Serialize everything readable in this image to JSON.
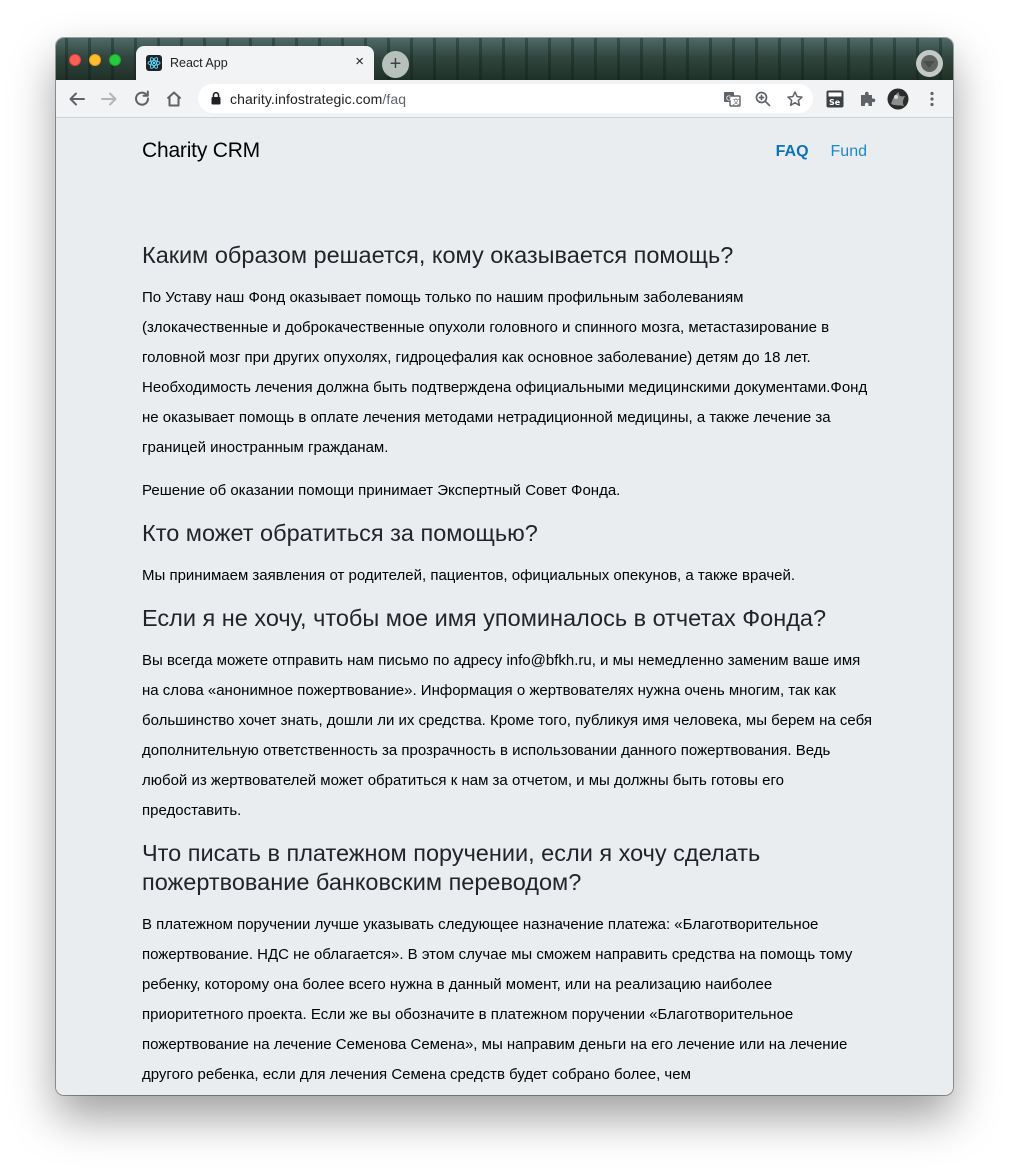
{
  "browser": {
    "tab_title": "React App",
    "tab_close": "×",
    "new_tab": "+",
    "url_host": "charity.infostrategic.com",
    "url_path": "/faq",
    "colors": {
      "traffic_red": "#fe5f57",
      "traffic_yellow": "#febc2e",
      "traffic_green": "#28c840"
    }
  },
  "header": {
    "brand": "Charity CRM",
    "nav": [
      {
        "label": "FAQ",
        "active": true
      },
      {
        "label": "Fund",
        "active": false
      }
    ],
    "link_color": "#1e87c9"
  },
  "faq": [
    {
      "question": "Каким образом решается, кому оказывается помощь?",
      "answers": [
        "По Уставу наш Фонд оказывает помощь только по нашим профильным заболеваниям (злокачественные и доброкачественные опухоли головного и спинного мозга, метастазирование в головной мозг при других опухолях, гидроцефалия как основное заболевание) детям до 18 лет. Необходимость лечения должна быть подтверждена официальными медицинскими документами.Фонд не оказывает помощь в оплате лечения методами нетрадиционной медицины, а также лечение за границей иностранным гражданам.",
        "Решение об оказании помощи принимает Экспертный Совет Фонда."
      ]
    },
    {
      "question": "Кто может обратиться за помощью?",
      "answers": [
        "Мы принимаем заявления от родителей, пациентов, официальных опекунов, а также врачей."
      ]
    },
    {
      "question": "Если я не хочу, чтобы мое имя упоминалось в отчетах Фонда?",
      "answers": [
        "Вы всегда можете отправить нам письмо по адресу info@bfkh.ru, и мы немедленно заменим ваше имя на слова «анонимное пожертвование». Информация о жертвователях нужна очень многим, так как большинство хочет знать, дошли ли их средства. Кроме того, публикуя имя человека, мы берем на себя дополнительную ответственность за прозрачность в использовании данного пожертвования. Ведь любой из жертвователей может обратиться к нам за отчетом, и мы должны быть готовы его предоставить."
      ]
    },
    {
      "question": "Что писать в платежном поручении, если я хочу сделать пожертвование банковским переводом?",
      "answers": [
        "В платежном поручении лучше указывать следующее назначение платежа: «Благотворительное пожертвование. НДС не облагается». В этом случае мы сможем направить средства на помощь тому ребенку, которому она более всего нужна в данный момент, или на реализацию наиболее приоритетного проекта. Если же вы обозначите в платежном поручении «Благотворительное пожертвование на лечение Семенова Семена», мы направим деньги на его лечение или на лечение другого ребенка, если для лечения Семена средств будет собрано более, чем"
      ]
    }
  ]
}
